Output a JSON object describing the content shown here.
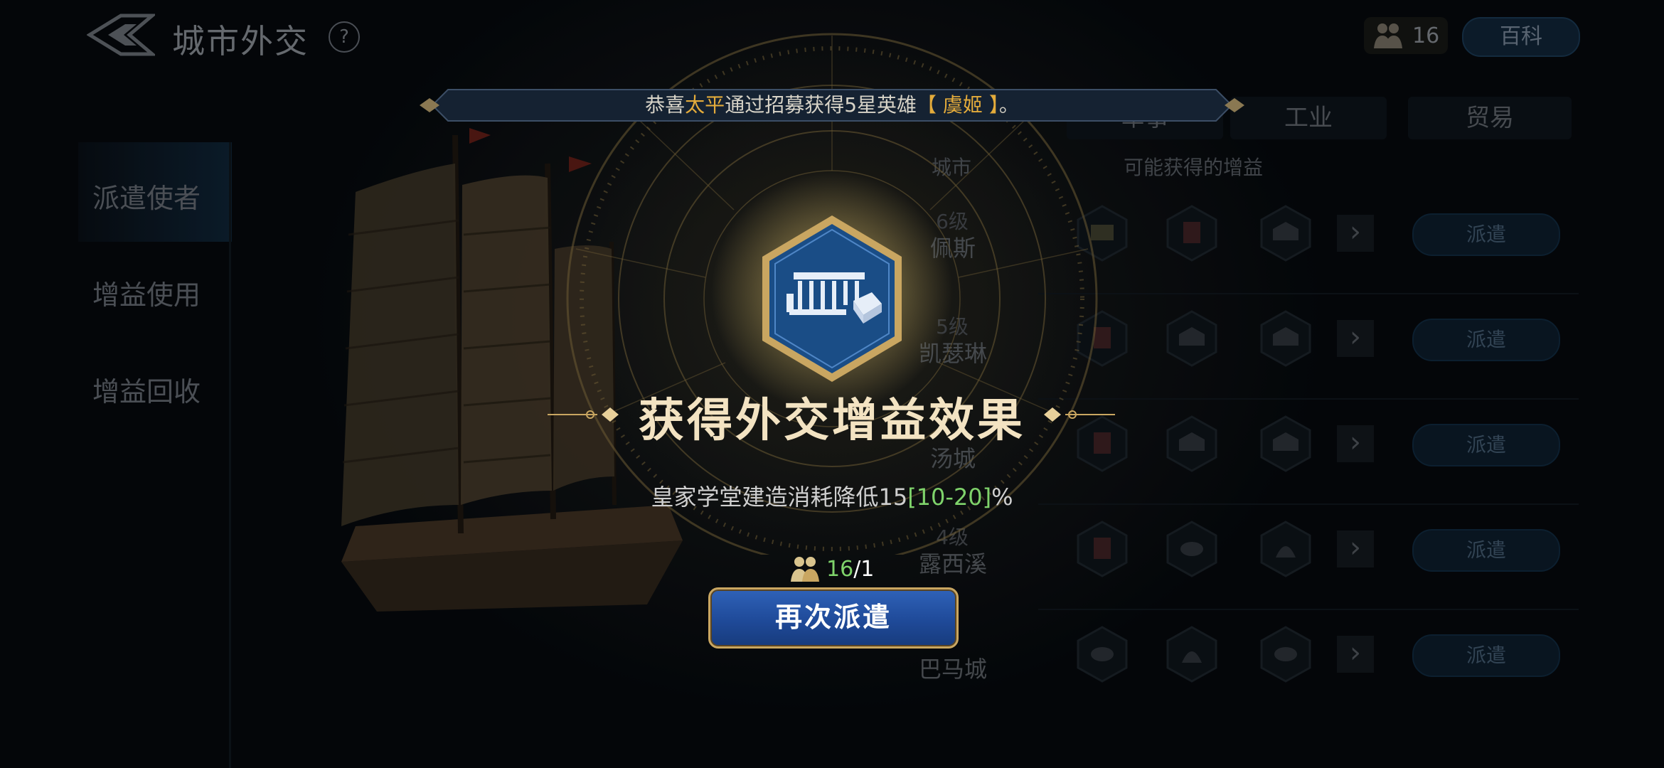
{
  "header": {
    "title": "城市外交",
    "help_label": "?",
    "population_value": "16",
    "wiki_label": "百科"
  },
  "sidebar": {
    "items": [
      {
        "label": "派遣使者",
        "active": true
      },
      {
        "label": "增益使用",
        "active": false
      },
      {
        "label": "增益回收",
        "active": false
      }
    ]
  },
  "panel": {
    "tabs": [
      "军事",
      "工业",
      "贸易"
    ],
    "city_header": "城市",
    "gain_header": "可能获得的增益",
    "rows": [
      {
        "level": "6级",
        "name": "佩斯",
        "send_label": "派遣"
      },
      {
        "level": "5级",
        "name": "凯瑟琳",
        "send_label": "派遣"
      },
      {
        "level": "",
        "name": "汤城",
        "send_label": "派遣"
      },
      {
        "level": "4级",
        "name": "露西溪",
        "send_label": "派遣"
      },
      {
        "level": "",
        "name": "巴马城",
        "send_label": "派遣"
      }
    ]
  },
  "notice": {
    "prefix": "恭喜",
    "player": "太平",
    "middle": "通过招募获得5星英雄",
    "hero": "【 虞姬 】",
    "suffix": "。"
  },
  "reward": {
    "title": "获得外交增益效果",
    "desc_main": "皇家学堂建造消耗降低15",
    "desc_range": "[10-20]",
    "desc_unit": "%",
    "cost_have": "16",
    "cost_sep": "/1",
    "redispatch_label": "再次派遣"
  },
  "colors": {
    "accent_gold": "#e3ab3b",
    "range_green": "#7fd36b",
    "button_blue": "#1f4a99"
  }
}
